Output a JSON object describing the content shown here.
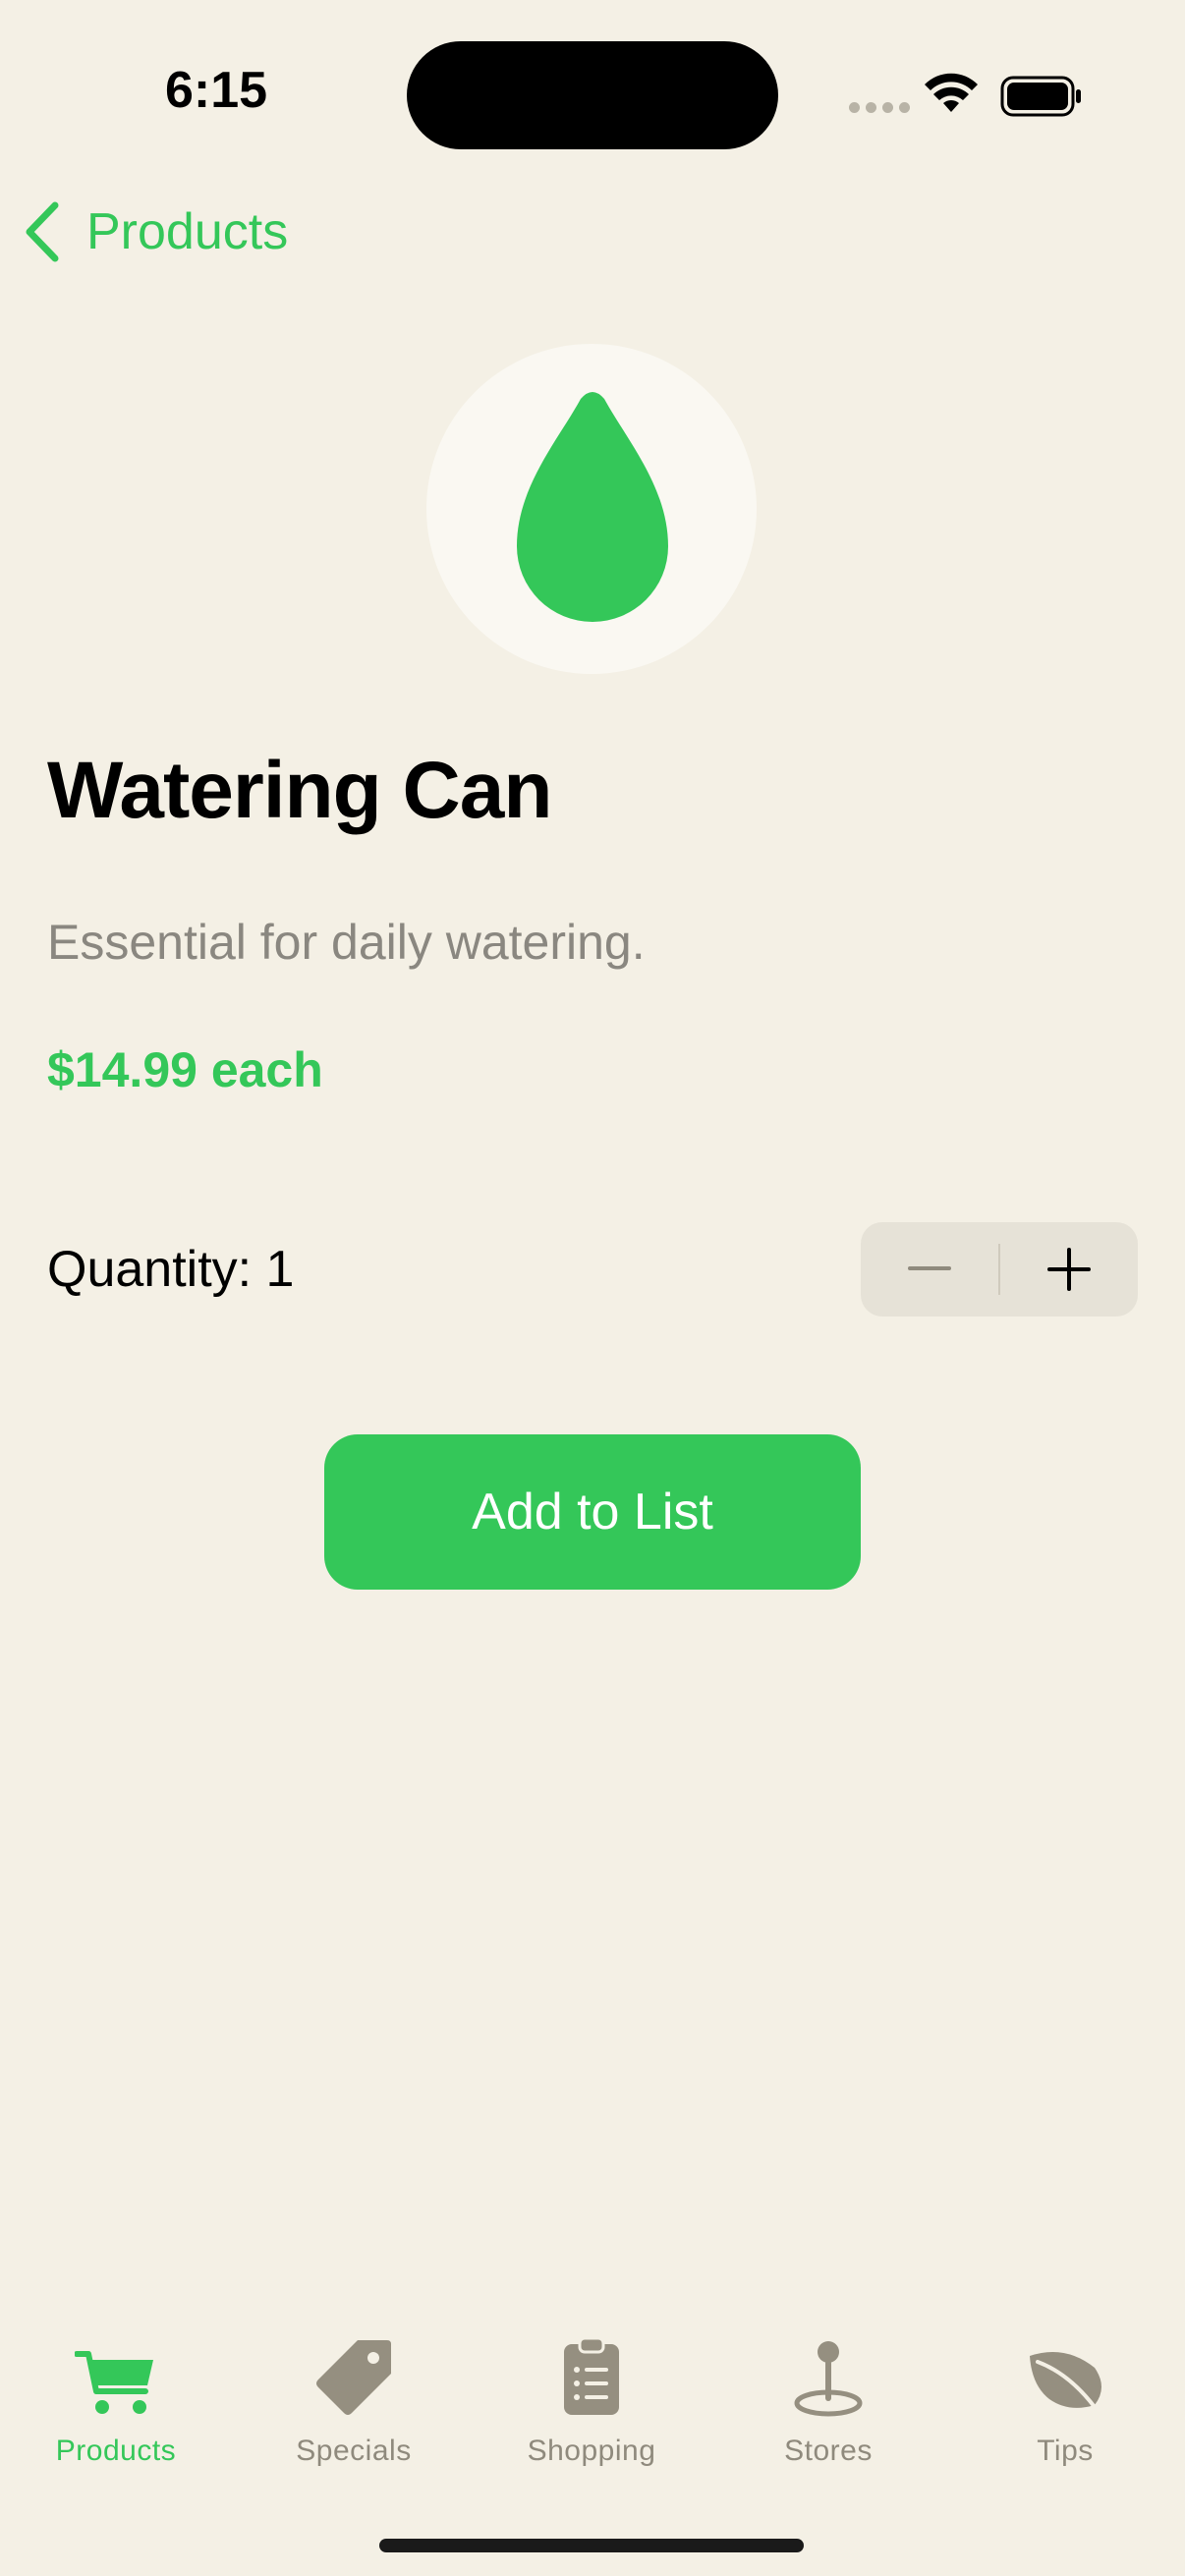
{
  "status_bar": {
    "time": "6:15"
  },
  "nav": {
    "back_label": "Products"
  },
  "product": {
    "icon": "water-drop-icon",
    "name": "Watering Can",
    "description": "Essential for daily watering.",
    "price": "$14.99 each",
    "quantity_label": "Quantity: 1"
  },
  "actions": {
    "add_label": "Add to List"
  },
  "tabs": [
    {
      "label": "Products",
      "icon": "cart-icon",
      "active": true
    },
    {
      "label": "Specials",
      "icon": "tag-icon",
      "active": false
    },
    {
      "label": "Shopping",
      "icon": "clipboard-list-icon",
      "active": false
    },
    {
      "label": "Stores",
      "icon": "map-pin-icon",
      "active": false
    },
    {
      "label": "Tips",
      "icon": "leaf-icon",
      "active": false
    }
  ],
  "colors": {
    "accent": "#34C759",
    "background": "#F4F0E5",
    "inactive_tab": "#8F8A7D"
  }
}
